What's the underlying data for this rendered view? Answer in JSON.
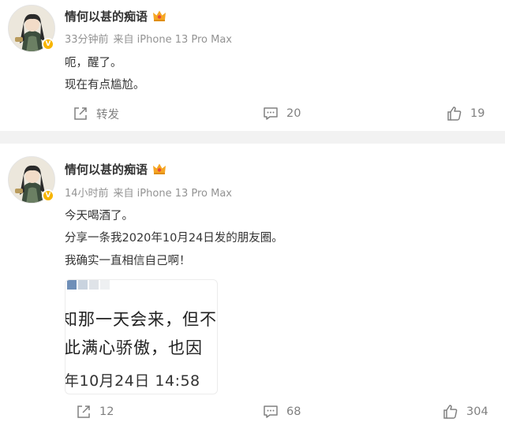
{
  "posts": [
    {
      "username": "情何以甚的痴语",
      "time": "33分钟前",
      "source": "来自 iPhone 13 Pro Max",
      "lines": [
        "呃，醒了。",
        "现在有点尴尬。"
      ],
      "actions": {
        "repost": "转发",
        "comment": "20",
        "like": "19"
      }
    },
    {
      "username": "情何以甚的痴语",
      "time": "14小时前",
      "source": "来自 iPhone 13 Pro Max",
      "lines": [
        "今天喝酒了。",
        "分享一条我2020年10月24日发的朋友圈。",
        "我确实一直相信自己啊！"
      ],
      "embed": {
        "line1": "知那一天会来，但不",
        "line2": "此满心骄傲，也因",
        "line3": "年10月24日 14:58"
      },
      "actions": {
        "repost": "12",
        "comment": "68",
        "like": "304"
      }
    }
  ],
  "icons": {
    "verified": "verified-badge-icon",
    "crown": "crown-icon",
    "repost": "repost-icon",
    "comment": "comment-icon",
    "like": "thumbs-up-icon"
  },
  "colors": {
    "username": "#333333",
    "meta": "#939393",
    "action": "#808080",
    "badge": "#f7b500"
  }
}
